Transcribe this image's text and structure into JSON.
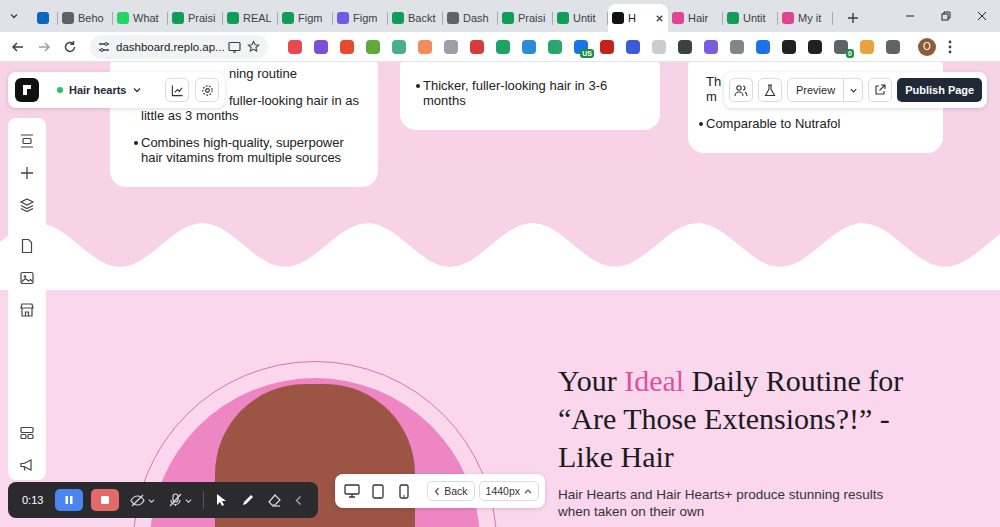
{
  "browser": {
    "tabs": [
      {
        "label": "",
        "color": "#0a66c2",
        "selected": false
      },
      {
        "label": "Beho",
        "color": "#5f6368",
        "selected": false
      },
      {
        "label": "What",
        "color": "#25d366",
        "selected": false
      },
      {
        "label": "Praisi",
        "color": "#0f9d58",
        "selected": false
      },
      {
        "label": "REAL",
        "color": "#0f9d58",
        "selected": false
      },
      {
        "label": "Figm",
        "color": "#0f9d58",
        "selected": false
      },
      {
        "label": "Figm",
        "color": "#6c5ce7",
        "selected": false
      },
      {
        "label": "Backt",
        "color": "#0f9d58",
        "selected": false
      },
      {
        "label": "Dash",
        "color": "#5f6368",
        "selected": false
      },
      {
        "label": "Praisi",
        "color": "#0f9d58",
        "selected": false
      },
      {
        "label": "Untit",
        "color": "#0f9d58",
        "selected": false
      },
      {
        "label": "H",
        "color": "#111111",
        "selected": true
      },
      {
        "label": "Hair",
        "color": "#e0458f",
        "selected": false
      },
      {
        "label": "Untit",
        "color": "#0f9d58",
        "selected": false
      },
      {
        "label": "My it",
        "color": "#e0458f",
        "selected": false
      }
    ],
    "url": "dashboard.replo.ap...",
    "extensions": [
      {
        "color": "#e6494f",
        "badge": ""
      },
      {
        "color": "#7b4fd6",
        "badge": ""
      },
      {
        "color": "#e84a2f",
        "badge": ""
      },
      {
        "color": "#5fa83a",
        "badge": ""
      },
      {
        "color": "#49b08d",
        "badge": ""
      },
      {
        "color": "#ef8d5c",
        "badge": ""
      },
      {
        "color": "#9aa0a6",
        "badge": ""
      },
      {
        "color": "#d83b3b",
        "badge": ""
      },
      {
        "color": "#1ea362",
        "badge": ""
      },
      {
        "color": "#2a8bd6",
        "badge": ""
      },
      {
        "color": "#2aa571",
        "badge": ""
      },
      {
        "color": "#1a73e8",
        "badge": "US"
      },
      {
        "color": "#c5221f",
        "badge": ""
      },
      {
        "color": "#3b5bdb",
        "badge": ""
      },
      {
        "color": "#c9cdd2",
        "badge": ""
      },
      {
        "color": "#3c4043",
        "badge": ""
      },
      {
        "color": "#7c5cdb",
        "badge": ""
      },
      {
        "color": "#80868b",
        "badge": ""
      },
      {
        "color": "#1a73e8",
        "badge": ""
      },
      {
        "color": "#202124",
        "badge": ""
      },
      {
        "color": "#202124",
        "badge": ""
      },
      {
        "color": "#5f6368",
        "badge": "0"
      },
      {
        "color": "#e8a33d",
        "badge": ""
      },
      {
        "color": "#5f6368",
        "badge": ""
      }
    ],
    "profile": "O"
  },
  "editor": {
    "project": "Hair hearts",
    "preview": "Preview",
    "publish": "Publish Page",
    "back": "Back",
    "viewport": "1440px"
  },
  "recorder": {
    "time": "0:13"
  },
  "page": {
    "cards": [
      {
        "items": [
          {
            "bullet": false,
            "hidden_start": true,
            "lines": [
              "ning routine"
            ]
          },
          {
            "bullet": false,
            "hidden_start": true,
            "lines": [
              "fuller-looking hair in as",
              "little as 3 months"
            ]
          },
          {
            "bullet": true,
            "hidden_start": false,
            "lines": [
              "Combines high-quality, superpower",
              "hair vitamins from multiple sources"
            ]
          }
        ]
      },
      {
        "items": [
          {
            "bullet": true,
            "hidden_start": false,
            "lines": [
              "Thicker, fuller-looking hair in 3-6",
              "months"
            ]
          }
        ]
      },
      {
        "items": [
          {
            "bullet": false,
            "hidden_start": false,
            "lines": [
              "Th",
              "m"
            ]
          },
          {
            "bullet": true,
            "hidden_start": false,
            "lines": [
              "Comparable to Nutrafol"
            ]
          }
        ]
      }
    ],
    "heading": [
      [
        {
          "text": "Your ",
          "accent": false
        },
        {
          "text": "Ideal",
          "accent": true
        },
        {
          "text": " Daily Routine for",
          "accent": false
        }
      ],
      [
        {
          "text": "“Are Those Extensions?!” -",
          "accent": false
        }
      ],
      [
        {
          "text": "Like Hair",
          "accent": false
        }
      ]
    ],
    "paragraph": [
      "Hair Hearts and Hair Hearts+ produce stunning results",
      "when taken on their own"
    ]
  }
}
